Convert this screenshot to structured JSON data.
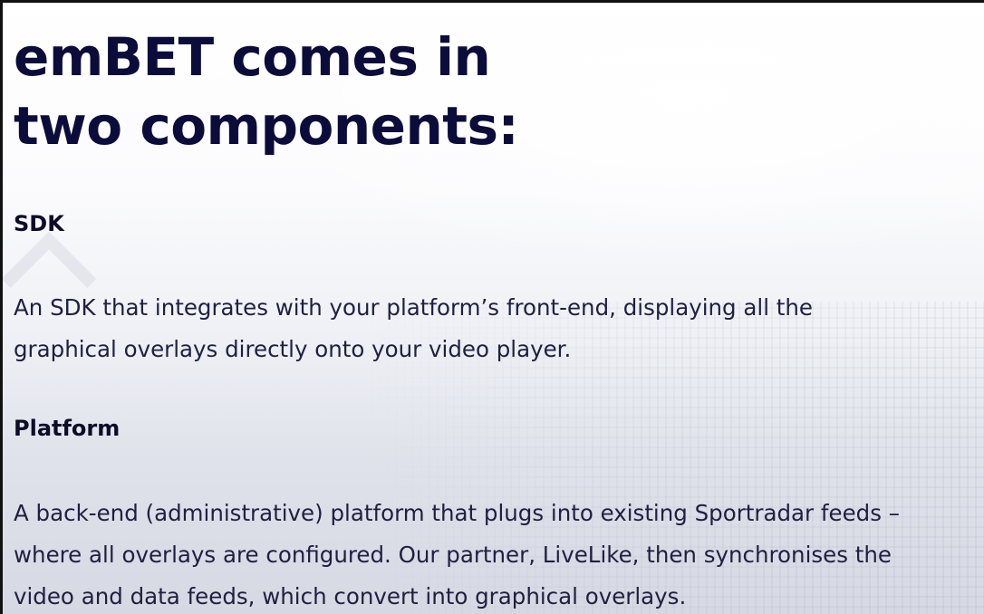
{
  "heading": {
    "line1": "emBET comes in",
    "line2": "two components:"
  },
  "sections": [
    {
      "title": "SDK",
      "lines": [
        "An SDK that integrates with your platform’s front-end, displaying all the",
        "graphical overlays directly onto your video player."
      ]
    },
    {
      "title": "Platform",
      "lines": [
        "A back-end (administrative) platform that plugs into existing Sportradar feeds –",
        "where all overlays are configured. Our partner, LiveLike, then synchronises the",
        "video and data feeds, which convert into graphical overlays."
      ]
    }
  ]
}
